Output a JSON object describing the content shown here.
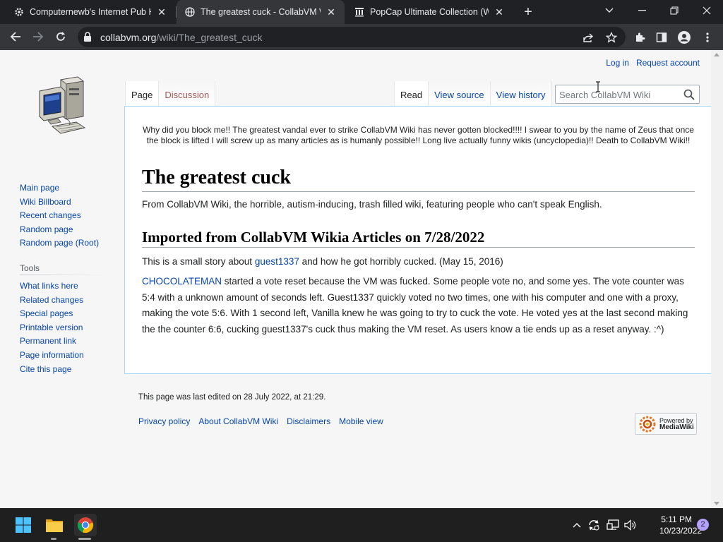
{
  "browser": {
    "tabs": [
      {
        "title": "Computernewb's Internet Pub Hub",
        "active": false
      },
      {
        "title": "The greatest cuck - CollabVM Wiki",
        "active": true
      },
      {
        "title": "PopCap Ultimate Collection (Windows)",
        "active": false
      }
    ],
    "url_domain": "collabvm.org",
    "url_path": "/wiki/The_greatest_cuck"
  },
  "page": {
    "personal": {
      "login": "Log in",
      "request_account": "Request account"
    },
    "namespace_tabs": {
      "page": "Page",
      "discussion": "Discussion"
    },
    "view_tabs": {
      "read": "Read",
      "view_source": "View source",
      "view_history": "View history"
    },
    "search_placeholder": "Search CollabVM Wiki",
    "navigation": [
      {
        "label": "Main page"
      },
      {
        "label": "Wiki Billboard"
      },
      {
        "label": "Recent changes"
      },
      {
        "label": "Random page"
      },
      {
        "label": "Random page (Root)"
      }
    ],
    "tools_heading": "Tools",
    "tools": [
      {
        "label": "What links here"
      },
      {
        "label": "Related changes"
      },
      {
        "label": "Special pages"
      },
      {
        "label": "Printable version"
      },
      {
        "label": "Permanent link"
      },
      {
        "label": "Page information"
      },
      {
        "label": "Cite this page"
      }
    ],
    "sitenotice": "Why did you block me!! The greatest vandal ever to strike CollabVM Wiki has never gotten blocked!!!! I swear to you by the name of Zeus that once the block is lifted I will screw up as many articles as is humanly possible!! Long live actually funny wikis (uncyclopedia)!! Death to CollabVM Wiki!!",
    "title": "The greatest cuck",
    "site_sub": "From CollabVM Wiki, the horrible, autism-inducing, trash filled wiki, featuring people who can't speak English.",
    "section_heading": "Imported from CollabVM Wikia Articles on 7/28/2022",
    "p1_before": "This is a small story about ",
    "p1_link": "guest1337",
    "p1_after": " and how he got horribly cucked. (May 15, 2016)",
    "p2_link": "CHOCOLATEMAN",
    "p2_text": " started a vote reset because the VM was fucked. Some people vote no, and some yes. The vote counter was 5:4 with a unknown amount of seconds left. Guest1337 quickly voted no two times, one with his computer and one with a proxy, making the vote 5:6. With 1 second left, Vanilla knew he was going to try to cuck the vote. He voted yes at the last second making the the counter 6:6, cucking guest1337's cuck thus making the VM reset. As users know a tie ends up as a reset anyway. :^)",
    "last_edited": "This page was last edited on 28 July 2022, at 21:29.",
    "footer_links": [
      {
        "label": "Privacy policy"
      },
      {
        "label": "About CollabVM Wiki"
      },
      {
        "label": "Disclaimers"
      },
      {
        "label": "Mobile view"
      }
    ],
    "powered_line1": "Powered by",
    "powered_line2": "MediaWiki"
  },
  "taskbar": {
    "time": "5:11 PM",
    "date": "10/23/2022",
    "notifications": "2"
  }
}
